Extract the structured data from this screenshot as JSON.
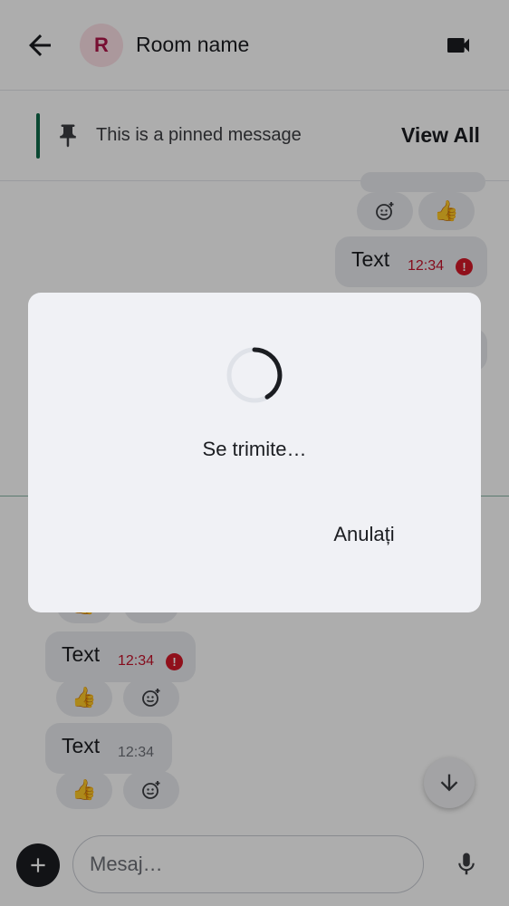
{
  "header": {
    "avatar_letter": "R",
    "room_name": "Room name"
  },
  "pinned": {
    "text": "This is a pinned message",
    "view_all": "View All"
  },
  "messages": [
    {
      "text": "Text",
      "time": "12:34",
      "failed": true
    },
    {
      "text": "Text",
      "time": "12:34",
      "failed": true
    },
    {
      "text": "Text",
      "time": "12:34",
      "failed": false
    }
  ],
  "reactions": {
    "thumbs": "👍"
  },
  "composer": {
    "placeholder": "Mesaj…"
  },
  "dialog": {
    "message": "Se trimite…",
    "cancel_label": "Anulați"
  },
  "colors": {
    "accent": "#0f6b4b",
    "error": "#d51928",
    "avatar_bg": "#fde0e6",
    "avatar_fg": "#b1174a"
  }
}
